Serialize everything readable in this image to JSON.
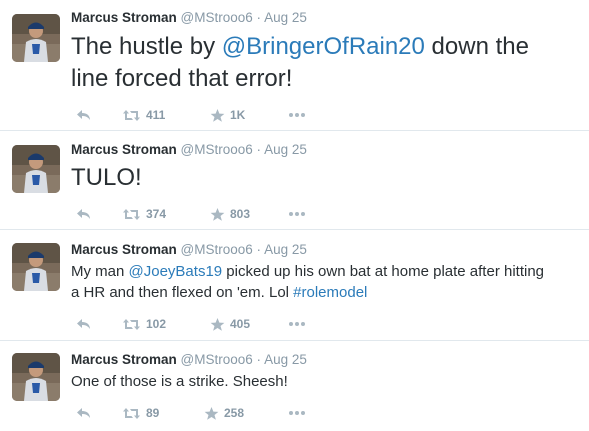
{
  "tweets": [
    {
      "name": "Marcus Stroman",
      "handle": "@MStrooo6",
      "sep": "·",
      "date": "Aug 25",
      "text_parts": [
        "The hustle by ",
        "@BringerOfRain20",
        " down the line forced that error!"
      ],
      "retweets": "411",
      "likes": "1K"
    },
    {
      "name": "Marcus Stroman",
      "handle": "@MStrooo6",
      "sep": "·",
      "date": "Aug 25",
      "text_parts": [
        "TULO!"
      ],
      "retweets": "374",
      "likes": "803"
    },
    {
      "name": "Marcus Stroman",
      "handle": "@MStrooo6",
      "sep": "·",
      "date": "Aug 25",
      "text_parts": [
        "My man ",
        "@JoeyBats19",
        " picked up his own bat at home plate after hitting a HR and then flexed on 'em. Lol ",
        "#rolemodel"
      ],
      "retweets": "102",
      "likes": "405"
    },
    {
      "name": "Marcus Stroman",
      "handle": "@MStrooo6",
      "sep": "·",
      "date": "Aug 25",
      "text_parts": [
        "One of those is a strike. Sheesh!"
      ],
      "retweets": "89",
      "likes": "258"
    }
  ],
  "icons": {
    "reply": "reply-icon",
    "retweet": "retweet-icon",
    "like": "star-icon",
    "more": "more-icon"
  },
  "colors": {
    "link": "#2b7bb9",
    "meta": "#8899a6",
    "icon": "#aab8c2",
    "divider": "#e1e8ed"
  }
}
